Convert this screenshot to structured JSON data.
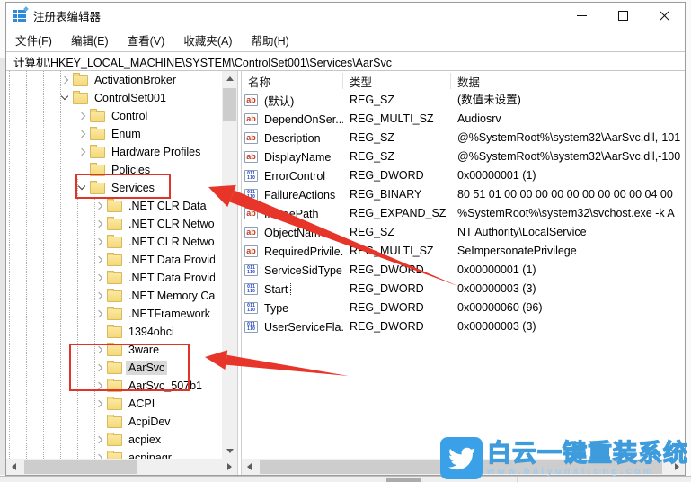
{
  "window": {
    "title": "注册表编辑器"
  },
  "menu": {
    "items": [
      "文件(F)",
      "编辑(E)",
      "查看(V)",
      "收藏夹(A)",
      "帮助(H)"
    ]
  },
  "address": {
    "path": "计算机\\HKEY_LOCAL_MACHINE\\SYSTEM\\ControlSet001\\Services\\AarSvc"
  },
  "tree": {
    "items": [
      {
        "label": "ActivationBroker",
        "level": 0,
        "state": "collapsed"
      },
      {
        "label": "ControlSet001",
        "level": 0,
        "state": "expanded"
      },
      {
        "label": "Control",
        "level": 1,
        "state": "collapsed"
      },
      {
        "label": "Enum",
        "level": 1,
        "state": "collapsed"
      },
      {
        "label": "Hardware Profiles",
        "level": 1,
        "state": "collapsed"
      },
      {
        "label": "Policies",
        "level": 1,
        "state": "leaf"
      },
      {
        "label": "Services",
        "level": 1,
        "state": "expanded"
      },
      {
        "label": ".NET CLR Data",
        "level": 2,
        "state": "collapsed"
      },
      {
        "label": ".NET CLR Networki",
        "level": 2,
        "state": "collapsed"
      },
      {
        "label": ".NET CLR Networki",
        "level": 2,
        "state": "collapsed"
      },
      {
        "label": ".NET Data Provider",
        "level": 2,
        "state": "collapsed"
      },
      {
        "label": ".NET Data Provider",
        "level": 2,
        "state": "collapsed"
      },
      {
        "label": ".NET Memory Cach",
        "level": 2,
        "state": "collapsed"
      },
      {
        "label": ".NETFramework",
        "level": 2,
        "state": "collapsed"
      },
      {
        "label": "1394ohci",
        "level": 2,
        "state": "leaf"
      },
      {
        "label": "3ware",
        "level": 2,
        "state": "collapsed"
      },
      {
        "label": "AarSvc",
        "level": 2,
        "state": "collapsed",
        "selected": true
      },
      {
        "label": "AarSvc_507b1",
        "level": 2,
        "state": "collapsed"
      },
      {
        "label": "ACPI",
        "level": 2,
        "state": "collapsed"
      },
      {
        "label": "AcpiDev",
        "level": 2,
        "state": "leaf"
      },
      {
        "label": "acpiex",
        "level": 2,
        "state": "collapsed"
      },
      {
        "label": "acpipagr",
        "level": 2,
        "state": "collapsed"
      }
    ]
  },
  "values": {
    "columns": [
      "名称",
      "类型",
      "数据"
    ],
    "icon_glyphs": {
      "string": "ab",
      "binary_top": "011",
      "binary_bottom": "110"
    },
    "rows": [
      {
        "name": "(默认)",
        "type": "REG_SZ",
        "data": "(数值未设置)",
        "icon": "string"
      },
      {
        "name": "DependOnSer...",
        "type": "REG_MULTI_SZ",
        "data": "Audiosrv",
        "icon": "string"
      },
      {
        "name": "Description",
        "type": "REG_SZ",
        "data": "@%SystemRoot%\\system32\\AarSvc.dll,-101",
        "icon": "string"
      },
      {
        "name": "DisplayName",
        "type": "REG_SZ",
        "data": "@%SystemRoot%\\system32\\AarSvc.dll,-100",
        "icon": "string"
      },
      {
        "name": "ErrorControl",
        "type": "REG_DWORD",
        "data": "0x00000001 (1)",
        "icon": "binary"
      },
      {
        "name": "FailureActions",
        "type": "REG_BINARY",
        "data": "80 51 01 00 00 00 00 00 00 00 00 00 04 00",
        "icon": "binary"
      },
      {
        "name": "ImagePath",
        "type": "REG_EXPAND_SZ",
        "data": "%SystemRoot%\\system32\\svchost.exe -k A",
        "icon": "string"
      },
      {
        "name": "ObjectName",
        "type": "REG_SZ",
        "data": "NT Authority\\LocalService",
        "icon": "string"
      },
      {
        "name": "RequiredPrivile...",
        "type": "REG_MULTI_SZ",
        "data": "SeImpersonatePrivilege",
        "icon": "string"
      },
      {
        "name": "ServiceSidType",
        "type": "REG_DWORD",
        "data": "0x00000001 (1)",
        "icon": "binary"
      },
      {
        "name": "Start",
        "type": "REG_DWORD",
        "data": "0x00000003 (3)",
        "icon": "binary",
        "focused": true
      },
      {
        "name": "Type",
        "type": "REG_DWORD",
        "data": "0x00000060 (96)",
        "icon": "binary"
      },
      {
        "name": "UserServiceFla...",
        "type": "REG_DWORD",
        "data": "0x00000003 (3)",
        "icon": "binary"
      }
    ]
  },
  "watermark": {
    "brand": "白云一键重装系统",
    "url": "www.baiyunxitong.com"
  },
  "colors": {
    "annotation_red": "#e0342b",
    "watermark_blue": "#3aa0e8",
    "selection_gray": "#d9d9d9"
  }
}
